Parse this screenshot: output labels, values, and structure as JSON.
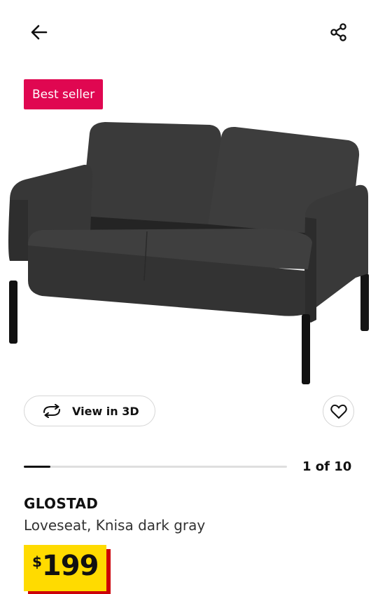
{
  "badge": {
    "label": "Best seller"
  },
  "actions": {
    "view3d_label": "View in 3D"
  },
  "gallery": {
    "counter": "1 of 10",
    "current": 1,
    "total": 10
  },
  "product": {
    "name": "GLOSTAD",
    "description": "Loveseat, Knisa dark gray",
    "price": {
      "currency": "$",
      "amount": "199"
    }
  },
  "colors": {
    "badge": "#e00751",
    "price_bg": "#ffdb00",
    "price_shadow": "#cc0008"
  },
  "icons": [
    "arrow-left-icon",
    "share-icon",
    "rotate-3d-icon",
    "heart-icon"
  ]
}
